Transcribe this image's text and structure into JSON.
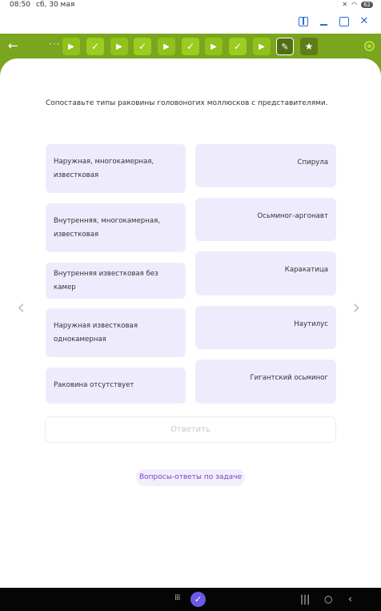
{
  "status_bar": {
    "time": "08:50",
    "date": "сб, 30 мая",
    "battery": "62"
  },
  "question": "Сопоставьте типы раковины головоногих моллюсков с представителями.",
  "left_items": [
    "Наружная, многокамерная, известковая",
    "Внутренняя, многокамерная, известковая",
    "Внутренняя известковая без камер",
    "Наружная известковая однокамерная",
    "Раковина отсутствует"
  ],
  "right_items": [
    "Спирула",
    "Осьминог-аргонавт",
    "Каракатица",
    "Наутилус",
    "Гигантский осьминог"
  ],
  "answer_button": "Ответить",
  "faq_link": "Вопросы-ответы по задаче",
  "nav_steps": [
    "play",
    "check",
    "play",
    "check",
    "play",
    "check",
    "play",
    "check",
    "play",
    "pencil",
    "star"
  ],
  "colors": {
    "accent_green": "#79a51f",
    "card_bg": "#eeecfc",
    "link_purple": "#7a42c8"
  }
}
